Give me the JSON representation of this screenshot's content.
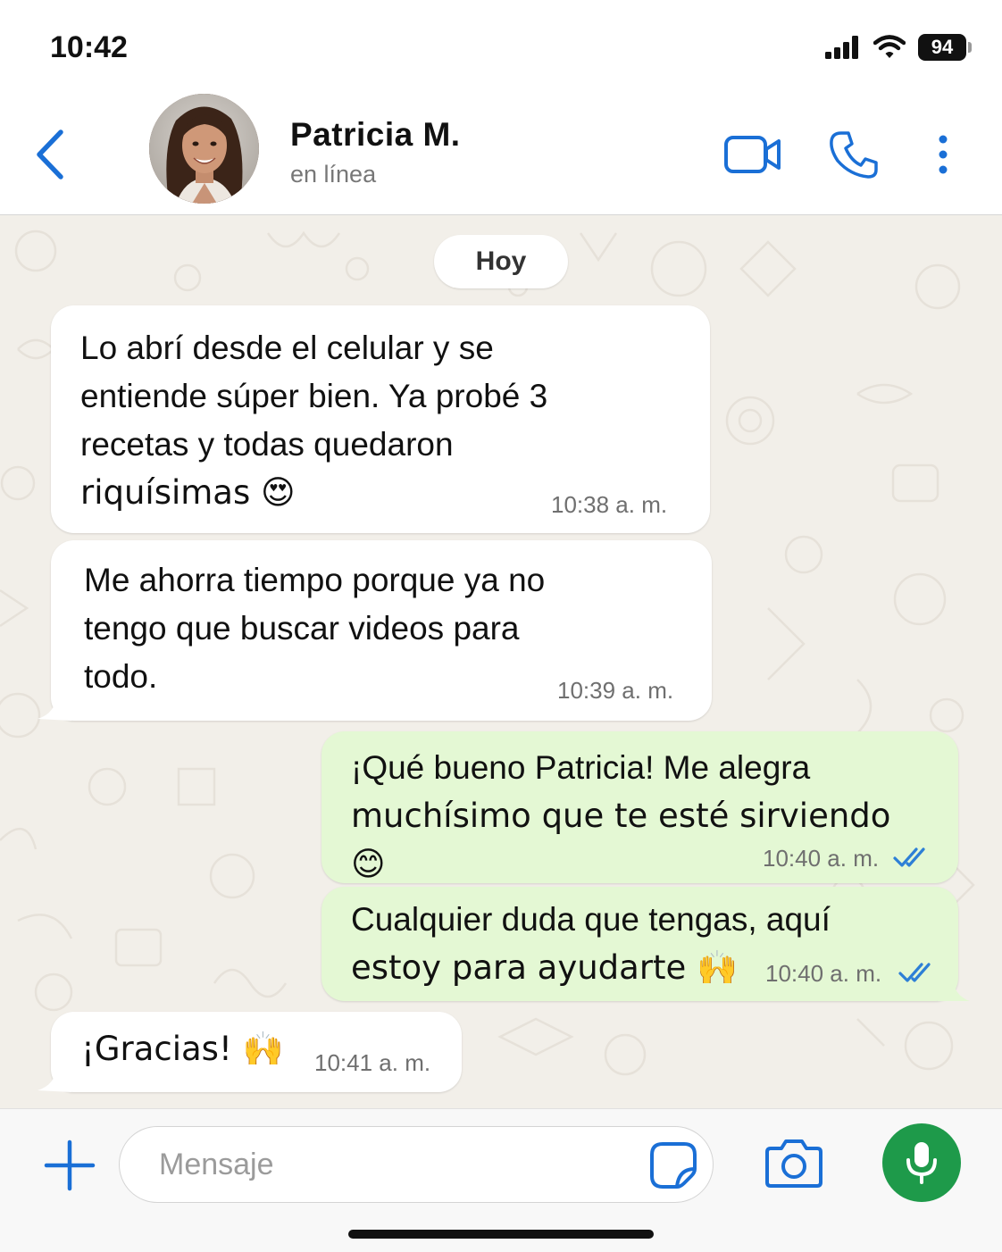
{
  "status_bar": {
    "time": "10:42",
    "battery": "94",
    "icons": [
      "signal-icon",
      "wifi-icon",
      "battery-icon"
    ]
  },
  "header": {
    "contact_name": "Patricia M.",
    "contact_status": "en línea",
    "icons": [
      "back-chevron-icon",
      "video-call-icon",
      "phone-icon",
      "more-vertical-icon"
    ],
    "accent_color": "#1a6fd6"
  },
  "chat": {
    "date_label": "Hoy",
    "messages": [
      {
        "direction": "in",
        "lines": [
          "Lo abrí desde el celular y se",
          "entiende súper bien. Ya probé 3",
          "recetas y todas quedaron",
          "riquísimas 😍"
        ],
        "time": "10:38 a. m."
      },
      {
        "direction": "in",
        "lines": [
          "Me ahorra tiempo porque ya no",
          "tengo que buscar videos para",
          "todo."
        ],
        "time": "10:39 a. m."
      },
      {
        "direction": "out",
        "lines": [
          "¡Qué bueno Patricia! Me alegra",
          "muchísimo que te esté sirviendo 😊"
        ],
        "time": "10:40 a. m.",
        "read": true
      },
      {
        "direction": "out",
        "lines": [
          "Cualquier duda que tengas, aquí",
          "estoy para ayudarte 🙌"
        ],
        "time": "10:40 a. m.",
        "read": true
      },
      {
        "direction": "in",
        "lines": [
          "¡Gracias! 🙌"
        ],
        "time": "10:41 a. m."
      }
    ],
    "colors": {
      "background": "#f2efe9",
      "incoming_bubble": "#ffffff",
      "outgoing_bubble": "#e4f8d4",
      "read_ticks": "#2d7fd6"
    }
  },
  "input_bar": {
    "placeholder": "Mensaje",
    "icons": [
      "plus-icon",
      "sticker-icon",
      "camera-icon",
      "microphone-icon"
    ],
    "mic_color": "#1e9a4a"
  }
}
